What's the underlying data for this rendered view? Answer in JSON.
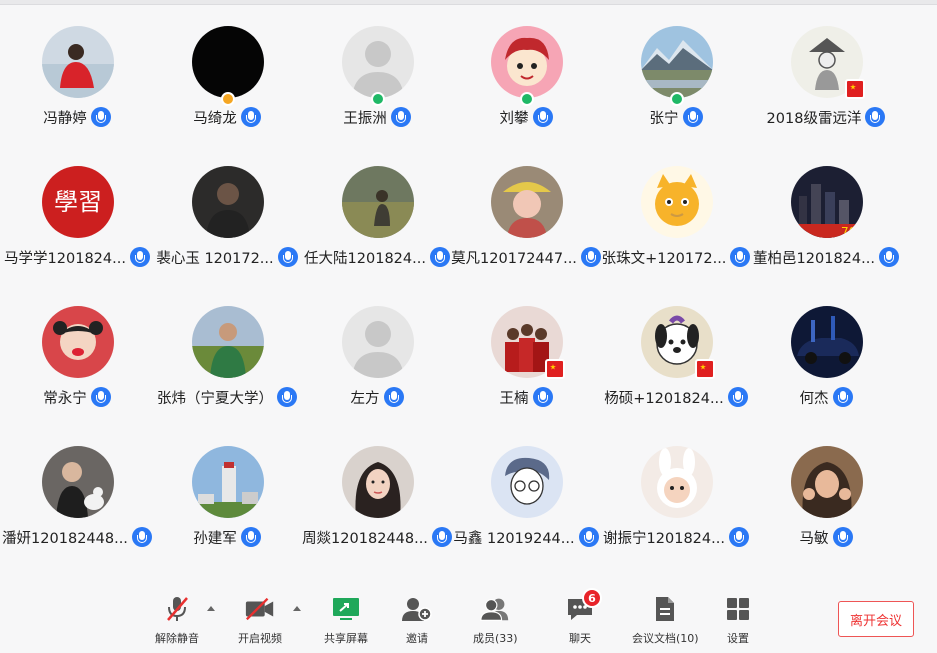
{
  "participants": [
    {
      "name": "冯静婷",
      "avatar": "photo-person-red-jacket",
      "badge": "",
      "flag": false
    },
    {
      "name": "马绮龙",
      "avatar": "black",
      "badge": "orange",
      "flag": false
    },
    {
      "name": "王振洲",
      "avatar": "default-silhouette",
      "badge": "green",
      "flag": false
    },
    {
      "name": "刘攀",
      "avatar": "cartoon-boy",
      "badge": "green",
      "flag": false
    },
    {
      "name": "张宁",
      "avatar": "photo-mountains",
      "badge": "green",
      "flag": false
    },
    {
      "name": "2018级雷远洋",
      "avatar": "sketch-figure",
      "badge": "",
      "flag": true
    },
    {
      "name": "马学学1201824...",
      "avatar": "red-calligraphy",
      "badge": "",
      "flag": false
    },
    {
      "name": "裴心玉 120172...",
      "avatar": "photo-dark-person",
      "badge": "",
      "flag": false
    },
    {
      "name": "任大陆1201824...",
      "avatar": "photo-field",
      "badge": "",
      "flag": false
    },
    {
      "name": "莫凡120172447...",
      "avatar": "photo-girl-hat",
      "badge": "",
      "flag": false
    },
    {
      "name": "张珠文+120172...",
      "avatar": "cartoon-cat",
      "badge": "",
      "flag": false
    },
    {
      "name": "董柏邑1201824...",
      "avatar": "photo-city-night",
      "badge": "",
      "flag": false
    },
    {
      "name": "常永宁",
      "avatar": "photo-child",
      "badge": "",
      "flag": false
    },
    {
      "name": "张炜（宁夏大学）",
      "avatar": "photo-man-grass",
      "badge": "",
      "flag": false
    },
    {
      "name": "左方",
      "avatar": "default-silhouette",
      "badge": "",
      "flag": false
    },
    {
      "name": "王楠",
      "avatar": "photo-group-red",
      "badge": "",
      "flag": true
    },
    {
      "name": "杨硕+1201824...",
      "avatar": "cartoon-dog",
      "badge": "",
      "flag": true
    },
    {
      "name": "何杰",
      "avatar": "photo-car-blue",
      "badge": "",
      "flag": false
    },
    {
      "name": "潘妍120182448...",
      "avatar": "photo-girl-dog",
      "badge": "",
      "flag": false
    },
    {
      "name": "孙建军",
      "avatar": "photo-building",
      "badge": "",
      "flag": false
    },
    {
      "name": "周燚120182448...",
      "avatar": "photo-woman-portrait",
      "badge": "",
      "flag": false
    },
    {
      "name": "马鑫 12019244...",
      "avatar": "cartoon-glasses-boy",
      "badge": "",
      "flag": false
    },
    {
      "name": "谢振宁1201824...",
      "avatar": "photo-baby-bunny",
      "badge": "",
      "flag": false
    },
    {
      "name": "马敏",
      "avatar": "photo-woman-gesture",
      "badge": "",
      "flag": false
    }
  ],
  "toolbar": {
    "unmute": "解除静音",
    "start_video": "开启视频",
    "share_screen": "共享屏幕",
    "invite": "邀请",
    "members": "成员(33)",
    "chat": "聊天",
    "chat_badge": "6",
    "docs": "会议文档(10)",
    "settings": "设置",
    "leave": "离开会议"
  },
  "colors": {
    "mic_blue": "#2a78f5",
    "leave_red": "#e33333",
    "share_green": "#1fa85a",
    "muted_red": "#e83030"
  }
}
